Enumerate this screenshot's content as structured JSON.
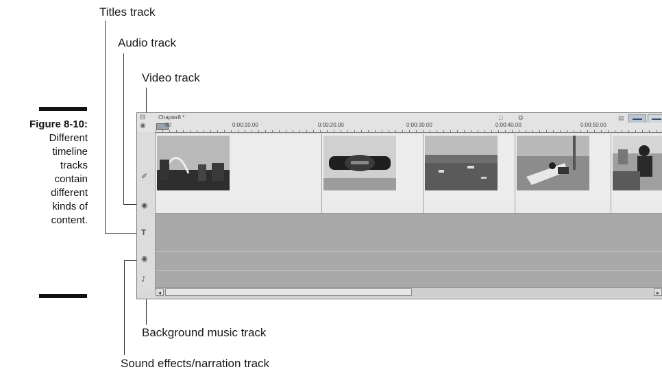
{
  "callouts": {
    "titles_track": "Titles track",
    "audio_track": "Audio track",
    "video_track": "Video track",
    "background_music_track": "Background music track",
    "sound_effects_track": "Sound effects/narration track"
  },
  "caption": {
    "figure_label": "Figure 8-10:",
    "lines": [
      "Different",
      "timeline",
      "tracks",
      "contain",
      "different",
      "kinds of",
      "content."
    ]
  },
  "timeline": {
    "project_name": "Chapter8 *",
    "ruler_labels": [
      "0:00:10.00",
      "0:00:20.00",
      "0:00:30.00",
      "0:00:40.00",
      "0:00:50.00"
    ],
    "ruler_start": "00",
    "scroll_left_icon": "scroll-left-arrow-icon",
    "scroll_right_icon": "scroll-right-arrow-icon",
    "track_icons": [
      "video-track-icon",
      "audio-track-icon",
      "title-track-icon",
      "sound-effects-track-icon",
      "music-track-icon"
    ]
  }
}
